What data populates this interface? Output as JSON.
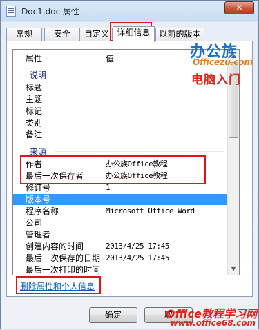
{
  "window": {
    "title": "Doc1.doc 属性",
    "close_label": "✕"
  },
  "tabs": [
    {
      "label": "常规"
    },
    {
      "label": "安全"
    },
    {
      "label": "自定义"
    },
    {
      "label": "详细信息",
      "active": true
    },
    {
      "label": "以前的版本"
    }
  ],
  "list": {
    "headers": {
      "property": "属性",
      "value": "值"
    },
    "groups": {
      "description": "说明",
      "origin": "来源"
    },
    "description_rows": [
      {
        "key": "标题",
        "value": ""
      },
      {
        "key": "主题",
        "value": ""
      },
      {
        "key": "标记",
        "value": ""
      },
      {
        "key": "类别",
        "value": ""
      },
      {
        "key": "备注",
        "value": ""
      }
    ],
    "origin_rows": [
      {
        "key": "作者",
        "value": "办公族Office教程"
      },
      {
        "key": "最后一次保存者",
        "value": "办公族Office教程"
      },
      {
        "key": "修订号",
        "value": "1"
      },
      {
        "key": "版本号",
        "value": "",
        "selected": true
      },
      {
        "key": "程序名称",
        "value": "Microsoft Office Word"
      },
      {
        "key": "公司",
        "value": ""
      },
      {
        "key": "管理者",
        "value": ""
      },
      {
        "key": "创建内容的时间",
        "value": "2013/4/25 17:45"
      },
      {
        "key": "最后一次保存的日期",
        "value": "2013/4/25 17:45"
      },
      {
        "key": "最后一次打印的时间",
        "value": ""
      }
    ]
  },
  "remove_link": "删除属性和个人信息",
  "buttons": {
    "ok": "确定",
    "cancel": "取"
  },
  "watermarks": {
    "logo_big": "办公族",
    "logo_site": "Officezu.com",
    "logo_sub": "电脑入门",
    "bottom_title": "Office教程学习网",
    "bottom_url": "www.office68.com"
  },
  "colors": {
    "selection": "#3399ff",
    "highlight_box": "#e0141e",
    "link": "#0a5ab4"
  }
}
